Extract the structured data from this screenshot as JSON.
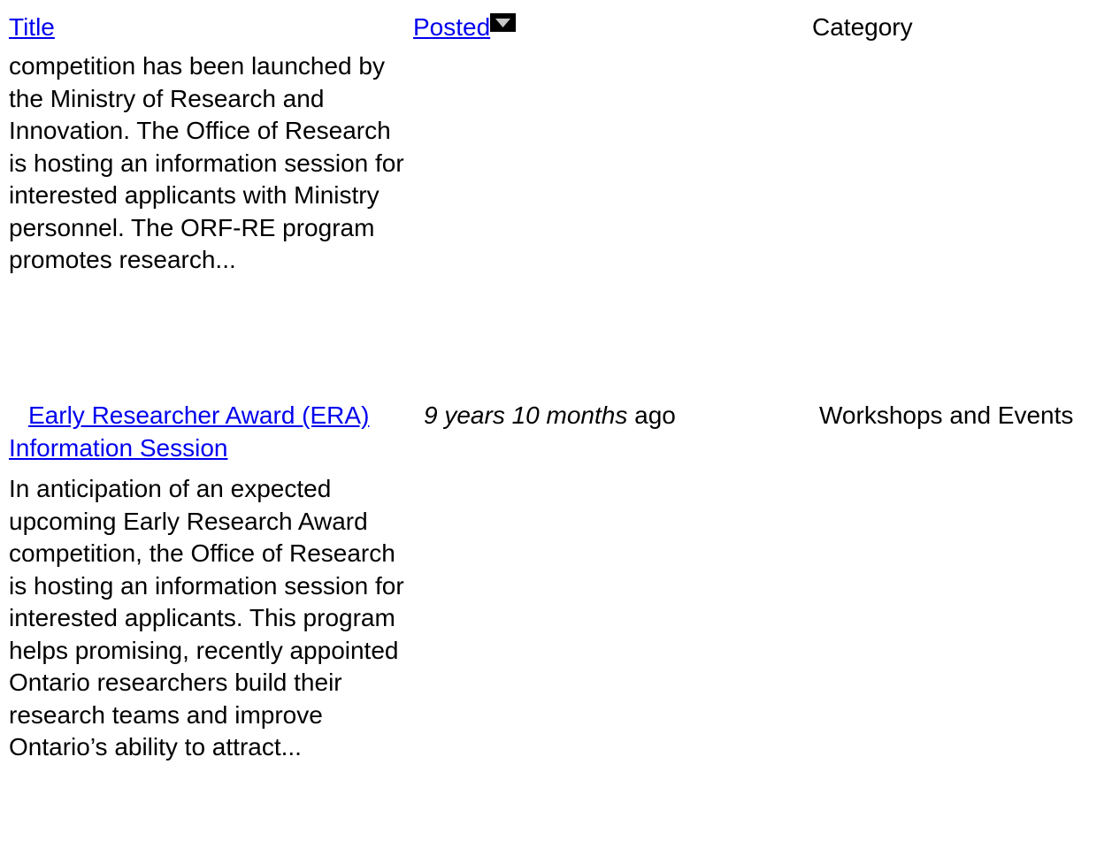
{
  "table": {
    "headers": {
      "title": "Title",
      "posted": "Posted",
      "category": "Category"
    },
    "sort_icon": "sort-descending-icon",
    "rows": [
      {
        "title": "",
        "teaser": "competition has been launched by the Ministry of Research and Innovation.  The Office of Research is hosting an information session for interested applicants with Ministry personnel. The ORF-RE program promotes research...",
        "posted_emphasis": "",
        "posted_suffix": "",
        "category": ""
      },
      {
        "title": "Early Researcher Award (ERA) Information Session",
        "teaser": "In anticipation of an expected upcoming Early Research Award competition, the Office of Research is hosting an information session for interested applicants.  This program helps promising, recently appointed Ontario researchers build their research teams and improve Ontario’s ability to attract...",
        "posted_emphasis": "9 years 10 months",
        "posted_suffix": " ago",
        "category": "Workshops and Events"
      }
    ]
  },
  "colors": {
    "link": "#0000ee",
    "text": "#000000",
    "background": "#ffffff"
  }
}
